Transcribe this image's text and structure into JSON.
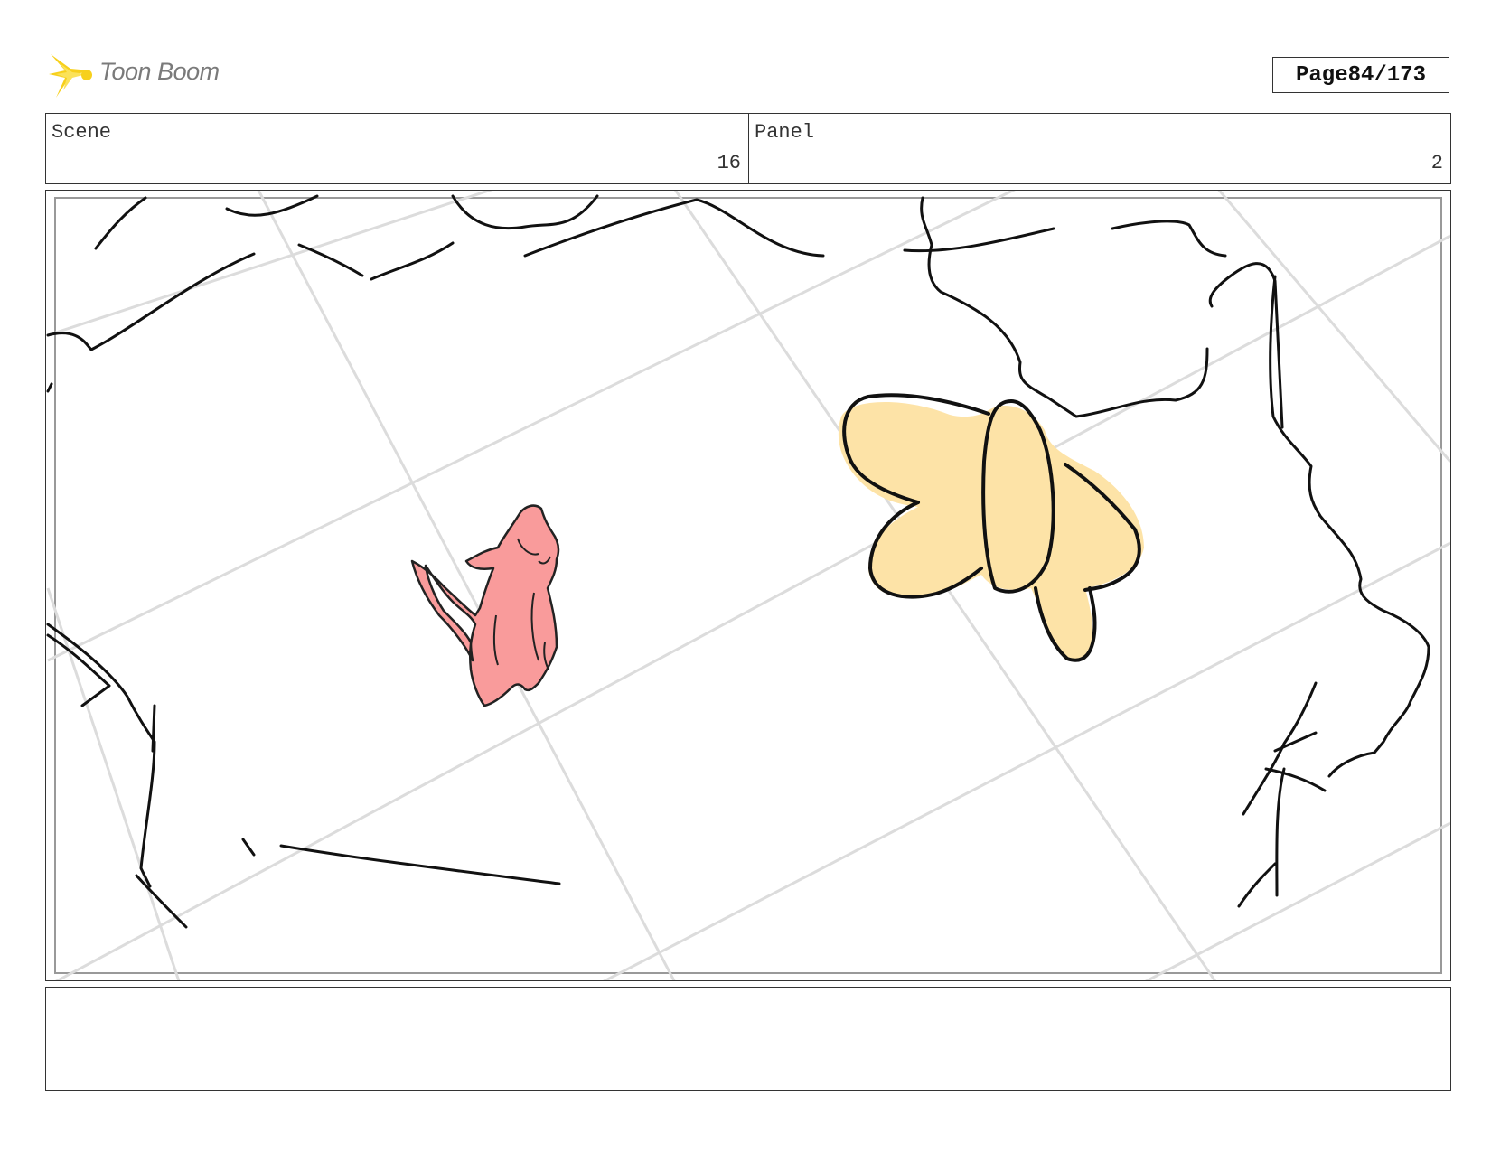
{
  "header": {
    "logo_text": "Toon Boom",
    "page_label": "Page",
    "page_number": "84/173"
  },
  "info": {
    "scene_label": "Scene",
    "scene_value": "16",
    "panel_label": "Panel",
    "panel_value": "2"
  },
  "colors": {
    "border": "#333333",
    "grid": "#dddddd",
    "ink": "#111111",
    "character_fill": "#f99b9b",
    "shape_fill": "#fde3a7",
    "logo_accent": "#f7d01c"
  },
  "drawing": {
    "characters": [
      "pink-cat-character",
      "yellow-bow-shape"
    ]
  },
  "notes": {
    "text": ""
  }
}
